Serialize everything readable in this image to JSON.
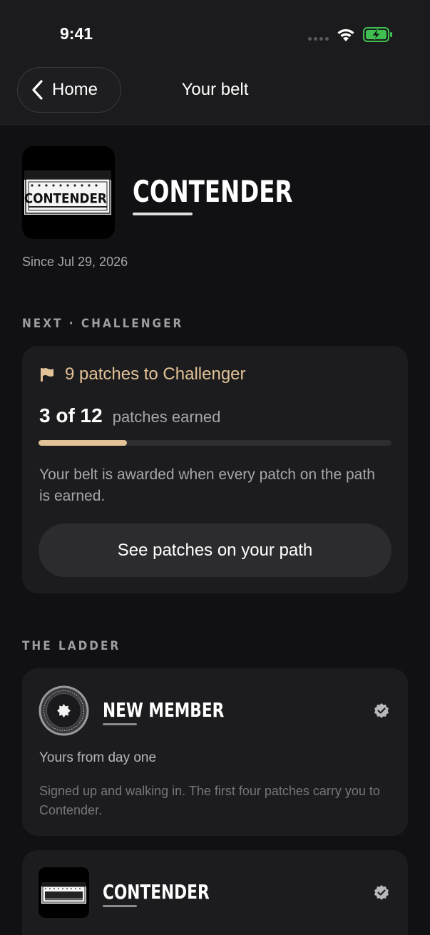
{
  "status": {
    "time": "9:41"
  },
  "nav": {
    "back_label": "Home",
    "title": "Your belt"
  },
  "hero": {
    "logo_text": "CONTENDER",
    "title": "CONTENDER",
    "since": "Since Jul 29, 2026"
  },
  "next": {
    "section_label": "NEXT · CHALLENGER",
    "headline": "9 patches to Challenger",
    "earned_text": "3 of 12",
    "earned_suffix": "patches earned",
    "progress": 0.25,
    "description": "Your belt is awarded when every patch on the path is earned.",
    "button_label": "See patches on your path"
  },
  "ladder": {
    "section_label": "THE LADDER",
    "items": [
      {
        "title": "NEW MEMBER",
        "subtitle": "Yours from day one",
        "description": "Signed up and walking in. The first four patches carry you to Contender.",
        "icon": "member-seal-icon"
      },
      {
        "title": "CONTENDER",
        "icon": "contender-patch-icon"
      }
    ]
  },
  "colors": {
    "accent": "#e3c297",
    "background": "#111113",
    "card": "#1c1c1e"
  }
}
